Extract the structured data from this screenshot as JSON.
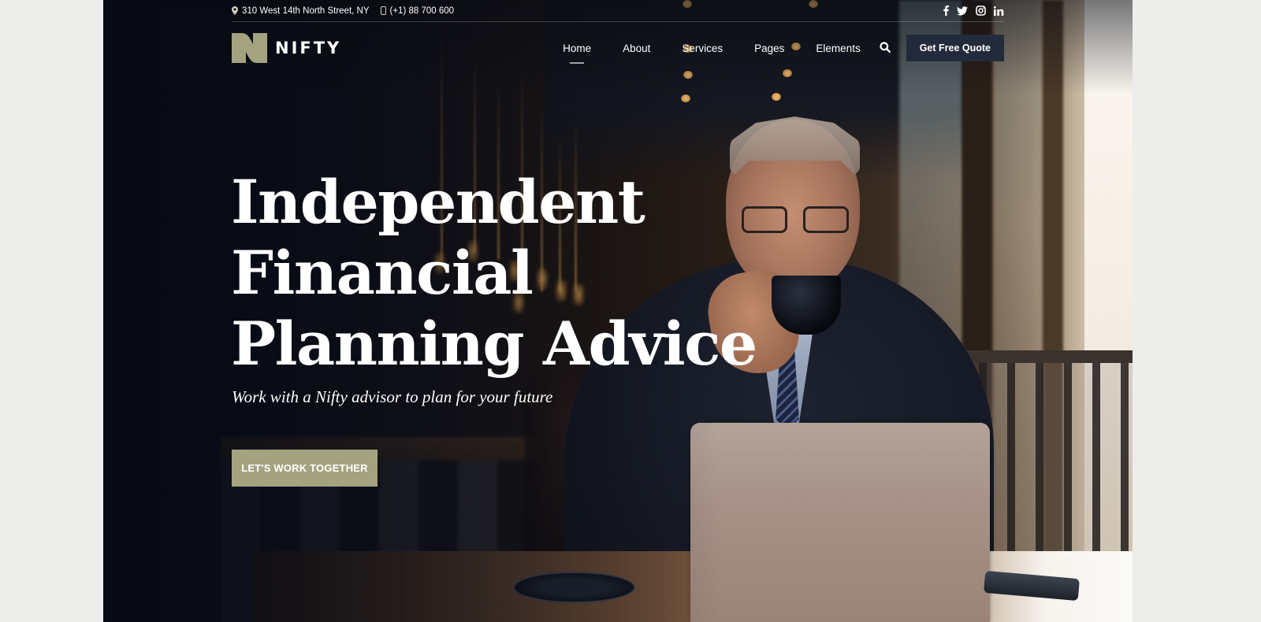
{
  "topbar": {
    "address": "310 West 14th North Street, NY",
    "phone": "(+1) 88 700 600",
    "social": [
      {
        "name": "facebook-icon",
        "glyph": "f"
      },
      {
        "name": "twitter-icon",
        "glyph": ""
      },
      {
        "name": "instagram-icon",
        "glyph": ""
      },
      {
        "name": "linkedin-icon",
        "glyph": "in"
      }
    ]
  },
  "brand": {
    "name": "NIFTY",
    "accent_color": "#a3a37f",
    "dark_color": "#222b3c"
  },
  "nav": {
    "items": [
      {
        "label": "Home",
        "active": true
      },
      {
        "label": "About",
        "active": false
      },
      {
        "label": "Services",
        "active": false
      },
      {
        "label": "Pages",
        "active": false
      },
      {
        "label": "Elements",
        "active": false
      }
    ],
    "search_icon": "search-icon",
    "cta_label": "Get Free Quote"
  },
  "hero": {
    "title_lines": [
      "Independent",
      "Financial",
      "Planning Advice"
    ],
    "subtitle": "Work with a Nifty advisor to plan for your future",
    "cta_label": "LET'S WORK TOGETHER"
  }
}
